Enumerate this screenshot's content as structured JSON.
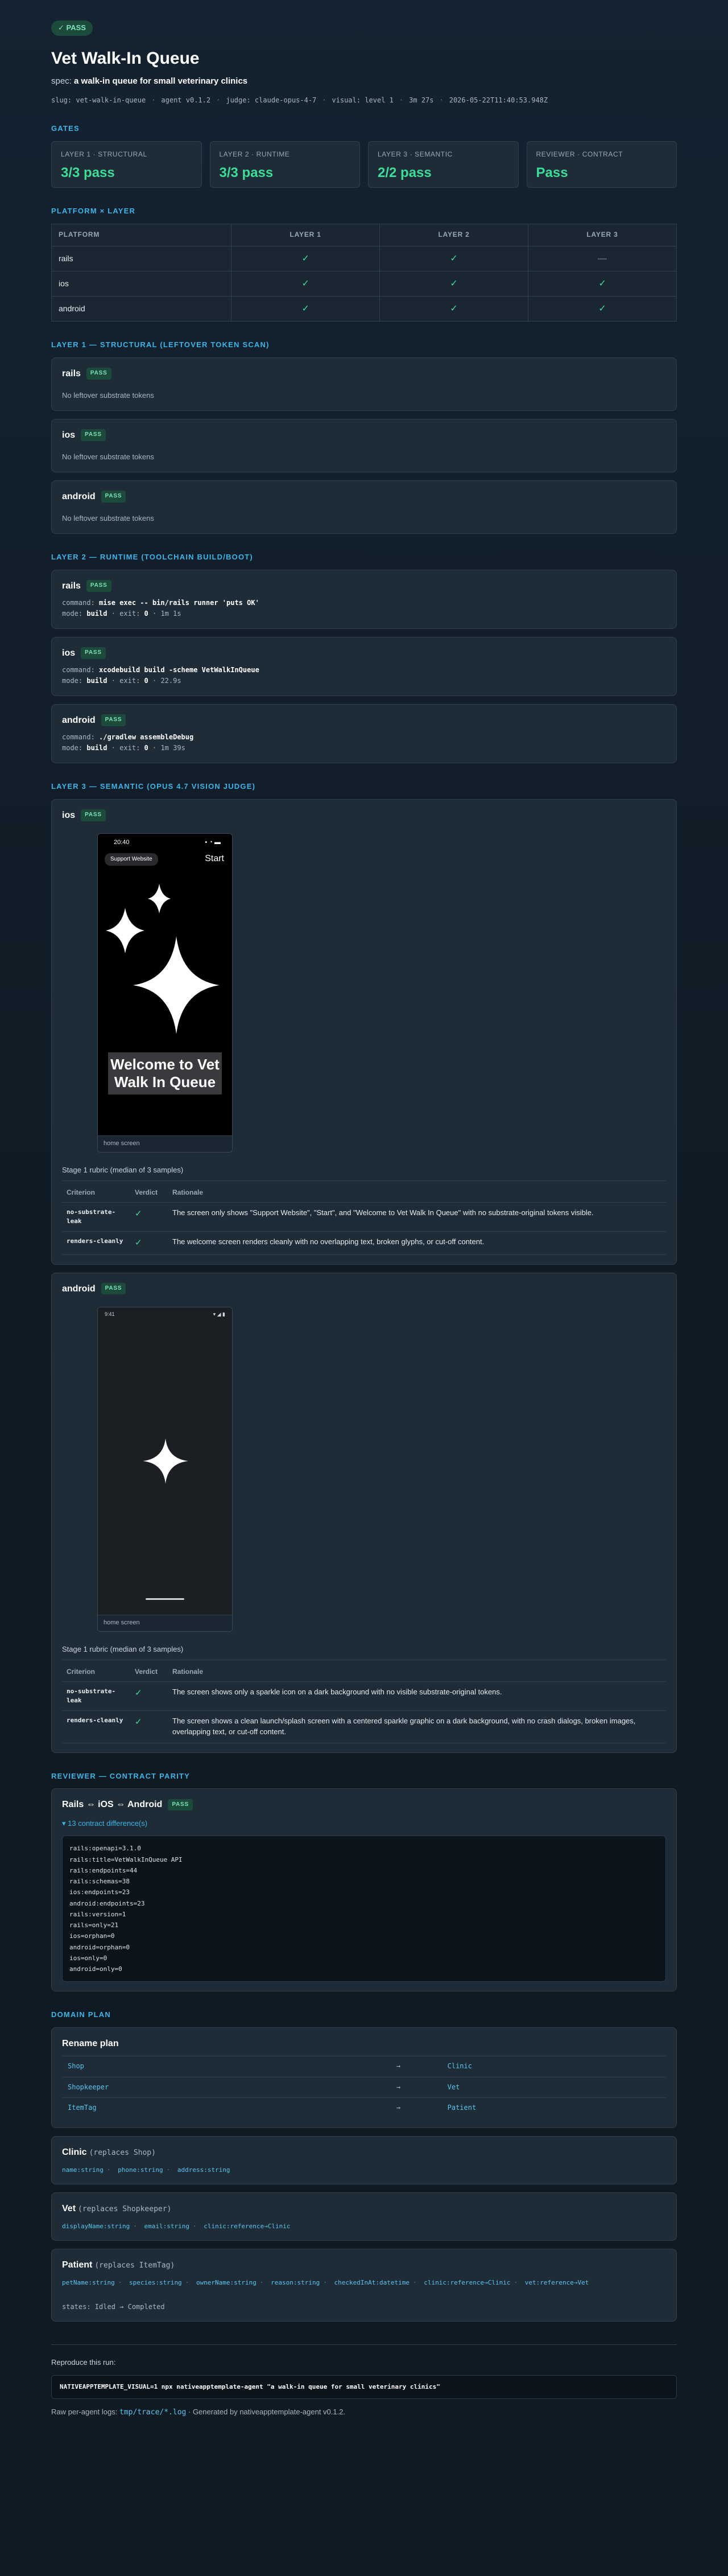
{
  "status_badge": "✓ PASS",
  "title": "Vet Walk-In Queue",
  "spec_label": "spec:",
  "spec_text": "a walk-in queue for small veterinary clinics",
  "meta": [
    "slug: vet-walk-in-queue",
    "agent v0.1.2",
    "judge: claude-opus-4-7",
    "visual: level 1",
    "3m 27s",
    "2026-05-22T11:40:53.948Z"
  ],
  "sections": {
    "gates": "GATES",
    "platform_layer": "PLATFORM × LAYER",
    "layer1": "LAYER 1 — STRUCTURAL (LEFTOVER TOKEN SCAN)",
    "layer2": "LAYER 2 — RUNTIME (TOOLCHAIN BUILD/BOOT)",
    "layer3": "LAYER 3 — SEMANTIC (OPUS 4.7 VISION JUDGE)",
    "reviewer": "REVIEWER — CONTRACT PARITY",
    "domain": "DOMAIN PLAN"
  },
  "gates": [
    {
      "label": "LAYER 1 · STRUCTURAL",
      "value": "3/3 pass"
    },
    {
      "label": "LAYER 2 · RUNTIME",
      "value": "3/3 pass"
    },
    {
      "label": "LAYER 3 · SEMANTIC",
      "value": "2/2 pass"
    },
    {
      "label": "REVIEWER · CONTRACT",
      "value": "Pass"
    }
  ],
  "matrix": {
    "headers": [
      "PLATFORM",
      "LAYER 1",
      "LAYER 2",
      "LAYER 3"
    ],
    "rows": [
      {
        "platform": "rails",
        "l1": "✓",
        "l2": "✓",
        "l3": "—"
      },
      {
        "platform": "ios",
        "l1": "✓",
        "l2": "✓",
        "l3": "✓"
      },
      {
        "platform": "android",
        "l1": "✓",
        "l2": "✓",
        "l3": "✓"
      }
    ]
  },
  "pass_pill": "PASS",
  "layer1": [
    {
      "name": "rails",
      "note": "No leftover substrate tokens"
    },
    {
      "name": "ios",
      "note": "No leftover substrate tokens"
    },
    {
      "name": "android",
      "note": "No leftover substrate tokens"
    }
  ],
  "layer2": [
    {
      "name": "rails",
      "command": "mise exec -- bin/rails runner 'puts OK'",
      "mode": "build",
      "exit": "0",
      "time": "1m 1s"
    },
    {
      "name": "ios",
      "command": "xcodebuild build -scheme VetWalkInQueue",
      "mode": "build",
      "exit": "0",
      "time": "22.9s"
    },
    {
      "name": "android",
      "command": "./gradlew assembleDebug",
      "mode": "build",
      "exit": "0",
      "time": "1m 39s"
    }
  ],
  "layer2_labels": {
    "command": "command:",
    "mode": "mode:",
    "exit": "exit:"
  },
  "layer3": {
    "ios": {
      "name": "ios",
      "status_time": "20:40",
      "support": "Support Website",
      "start": "Start",
      "welcome": "Welcome to Vet Walk In Queue",
      "screen_label": "home screen",
      "rubric_title": "Stage 1 rubric (median of 3 samples)",
      "rubric": [
        {
          "criterion": "no-substrate-leak",
          "verdict": "✓",
          "rationale": "The screen only shows \"Support Website\", \"Start\", and \"Welcome to Vet Walk In Queue\" with no substrate-original tokens visible."
        },
        {
          "criterion": "renders-cleanly",
          "verdict": "✓",
          "rationale": "The welcome screen renders cleanly with no overlapping text, broken glyphs, or cut-off content."
        }
      ]
    },
    "android": {
      "name": "android",
      "status_time": "9:41",
      "screen_label": "home screen",
      "rubric_title": "Stage 1 rubric (median of 3 samples)",
      "rubric": [
        {
          "criterion": "no-substrate-leak",
          "verdict": "✓",
          "rationale": "The screen shows only a sparkle icon on a dark background with no visible substrate-original tokens."
        },
        {
          "criterion": "renders-cleanly",
          "verdict": "✓",
          "rationale": "The screen shows a clean launch/splash screen with a centered sparkle graphic on a dark background, with no crash dialogs, broken images, overlapping text, or cut-off content."
        }
      ]
    },
    "rubric_headers": [
      "Criterion",
      "Verdict",
      "Rationale"
    ]
  },
  "reviewer": {
    "title": "Rails ⇔ iOS ⇔ Android",
    "toggle": "▾ 13 contract difference(s)",
    "lines": [
      "rails:openapi=3.1.0",
      "rails:title=VetWalkInQueue API",
      "rails:endpoints=44",
      "rails:schemas=38",
      "ios:endpoints=23",
      "android:endpoints=23",
      "rails:version=1",
      "rails=only=21",
      "ios=orphan=0",
      "android=orphan=0",
      "ios=only=0",
      "android=only=0"
    ]
  },
  "domain": {
    "rename_title": "Rename plan",
    "renames": [
      {
        "from": "Shop",
        "arrow": "→",
        "to": "Clinic"
      },
      {
        "from": "Shopkeeper",
        "arrow": "→",
        "to": "Vet"
      },
      {
        "from": "ItemTag",
        "arrow": "→",
        "to": "Patient"
      }
    ],
    "entities": [
      {
        "name": "Clinic",
        "replaces": "(replaces Shop)",
        "fields": [
          "name:string",
          "phone:string",
          "address:string"
        ]
      },
      {
        "name": "Vet",
        "replaces": "(replaces Shopkeeper)",
        "fields": [
          "displayName:string",
          "email:string",
          "clinic:reference→Clinic"
        ]
      },
      {
        "name": "Patient",
        "replaces": "(replaces ItemTag)",
        "fields": [
          "petName:string",
          "species:string",
          "ownerName:string",
          "reason:string",
          "checkedInAt:datetime",
          "clinic:reference→Clinic",
          "vet:reference→Vet"
        ],
        "states": "states: Idled → Completed"
      }
    ]
  },
  "footer": {
    "repro_label": "Reproduce this run:",
    "repro_cmd": "NATIVEAPPTEMPLATE_VISUAL=1 npx nativeapptemplate-agent \"a walk-in queue for small veterinary clinics\"",
    "raw_prefix": "Raw per-agent logs:",
    "raw_link": "tmp/trace/*.log",
    "raw_suffix": "· Generated by nativeapptemplate-agent v0.1.2."
  }
}
